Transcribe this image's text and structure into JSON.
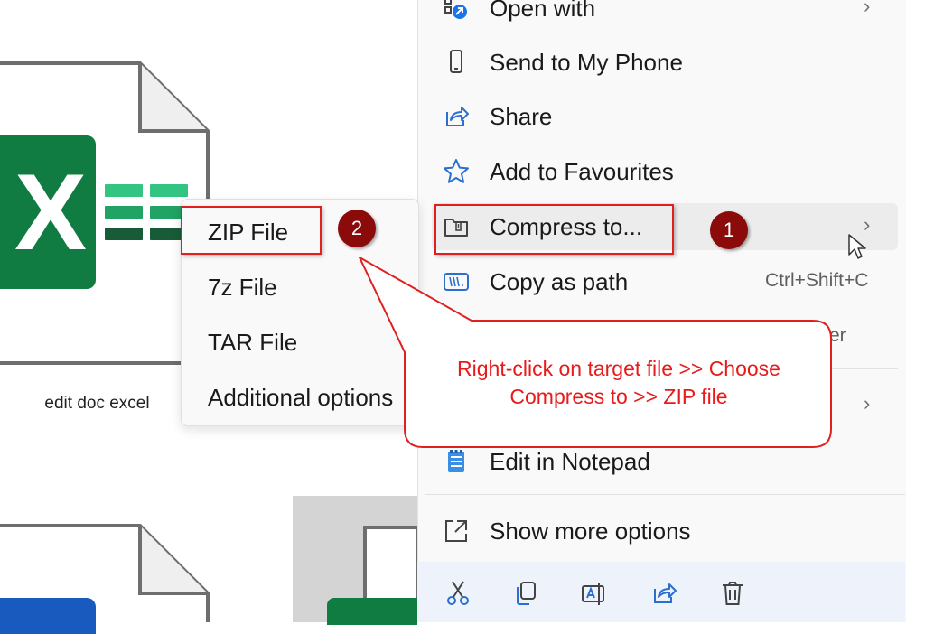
{
  "file": {
    "name": "edit doc excel",
    "app_letter": "X",
    "app_color": "#107c41"
  },
  "menu": {
    "items": [
      {
        "label": "Open with",
        "icon": "open-with-icon",
        "has_submenu": true
      },
      {
        "label": "Send to My Phone",
        "icon": "phone-icon"
      },
      {
        "label": "Share",
        "icon": "share-icon"
      },
      {
        "label": "Add to Favourites",
        "icon": "star-icon"
      },
      {
        "label": "Compress to...",
        "icon": "zip-folder-icon",
        "has_submenu": true,
        "highlighted": true
      },
      {
        "label": "Copy as path",
        "icon": "copy-path-icon",
        "shortcut": "Ctrl+Shift+C"
      },
      {
        "label": "Edit in Notepad",
        "icon": "notepad-icon"
      },
      {
        "label": "Show more options",
        "icon": "more-options-icon"
      }
    ],
    "obscured_fragment": "er",
    "toolbar": [
      "cut-icon",
      "copy-icon",
      "rename-icon",
      "share-icon",
      "delete-icon"
    ]
  },
  "submenu": {
    "items": [
      "ZIP File",
      "7z File",
      "TAR File",
      "Additional options"
    ]
  },
  "annotations": {
    "step1": "1",
    "step2": "2",
    "callout": "Right-click on target file >> Choose Compress to >> ZIP file",
    "highlight_color": "#e02020",
    "badge_color": "#8b0a0a"
  }
}
